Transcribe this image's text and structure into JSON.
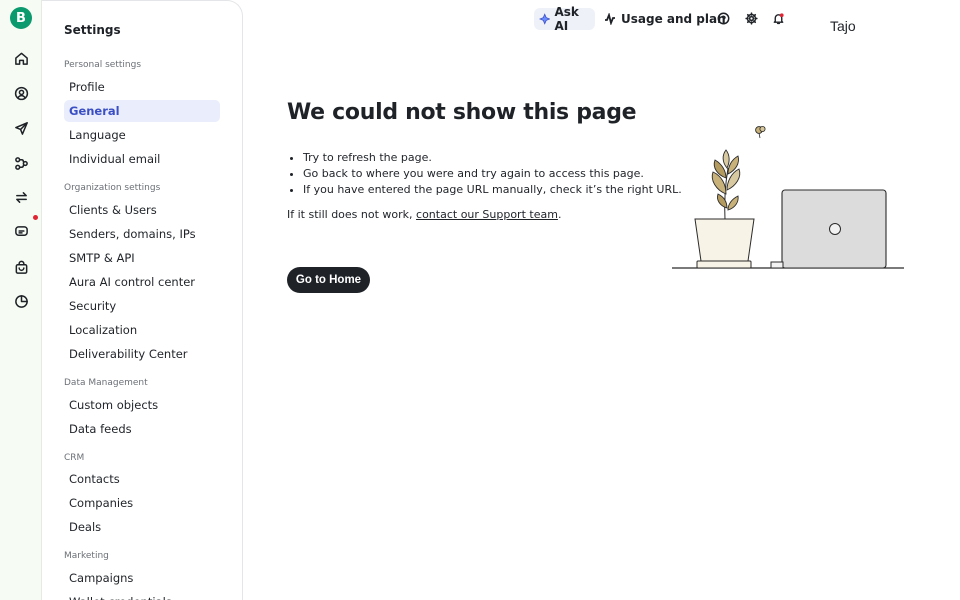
{
  "rail": {
    "logo_letter": "B",
    "items": [
      {
        "icon": "home-icon"
      },
      {
        "icon": "contacts-icon"
      },
      {
        "icon": "send-icon"
      },
      {
        "icon": "automation-icon"
      },
      {
        "icon": "sync-icon"
      },
      {
        "icon": "conversations-icon"
      },
      {
        "icon": "shop-icon"
      },
      {
        "icon": "reports-icon"
      }
    ],
    "notification_dot_color": "#e02434"
  },
  "panel": {
    "title": "Settings",
    "sections": [
      {
        "label": "Personal settings",
        "items": [
          "Profile",
          "General",
          "Language",
          "Individual email"
        ]
      },
      {
        "label": "Organization settings",
        "items": [
          "Clients & Users",
          "Senders, domains, IPs",
          "SMTP & API",
          "Aura AI control center",
          "Security",
          "Localization",
          "Deliverability Center"
        ]
      },
      {
        "label": "Data Management",
        "items": [
          "Custom objects",
          "Data feeds"
        ]
      },
      {
        "label": "CRM",
        "items": [
          "Contacts",
          "Companies",
          "Deals"
        ]
      },
      {
        "label": "Marketing",
        "items": [
          "Campaigns",
          "Wallet credentials"
        ]
      }
    ],
    "active_item": "General"
  },
  "topbar": {
    "ask_ai": "Ask AI",
    "usage": "Usage and plan",
    "user": "Tajo"
  },
  "main": {
    "title": "We could not show this page",
    "tips": [
      "Try to refresh the page.",
      "Go back to where you were and try again to access this page.",
      "If you have entered the page URL manually, check it’s the right URL."
    ],
    "still_prefix": "If it still does not work, ",
    "support_link": "contact our Support team",
    "still_suffix": ".",
    "home_button": "Go to Home"
  },
  "colors": {
    "brand": "#0b996e",
    "accent": "#3b4fc4",
    "active_bg": "#eaedfb",
    "button": "#1f2328"
  }
}
